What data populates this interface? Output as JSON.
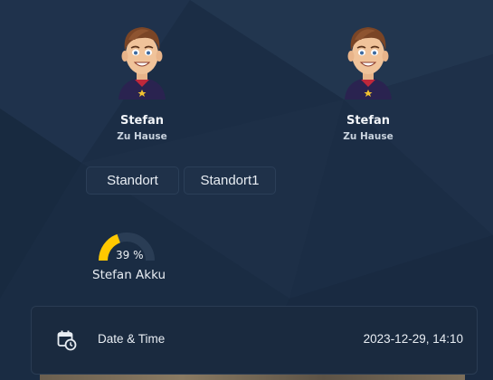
{
  "persons": [
    {
      "name": "Stefan",
      "status": "Zu Hause"
    },
    {
      "name": "Stefan",
      "status": "Zu Hause"
    }
  ],
  "chips": [
    {
      "label": "Standort"
    },
    {
      "label": "Standort1"
    }
  ],
  "gauge": {
    "value_text": "39 %",
    "value": 39,
    "label": "Stefan Akku",
    "color": "#ffc800"
  },
  "datetime": {
    "label": "Date & Time",
    "value": "2023-12-29, 14:10",
    "icon": "calendar-clock-icon"
  },
  "colors": {
    "background": "#1b2d45",
    "card": "#1a2a3f",
    "accent": "#ffc800"
  }
}
